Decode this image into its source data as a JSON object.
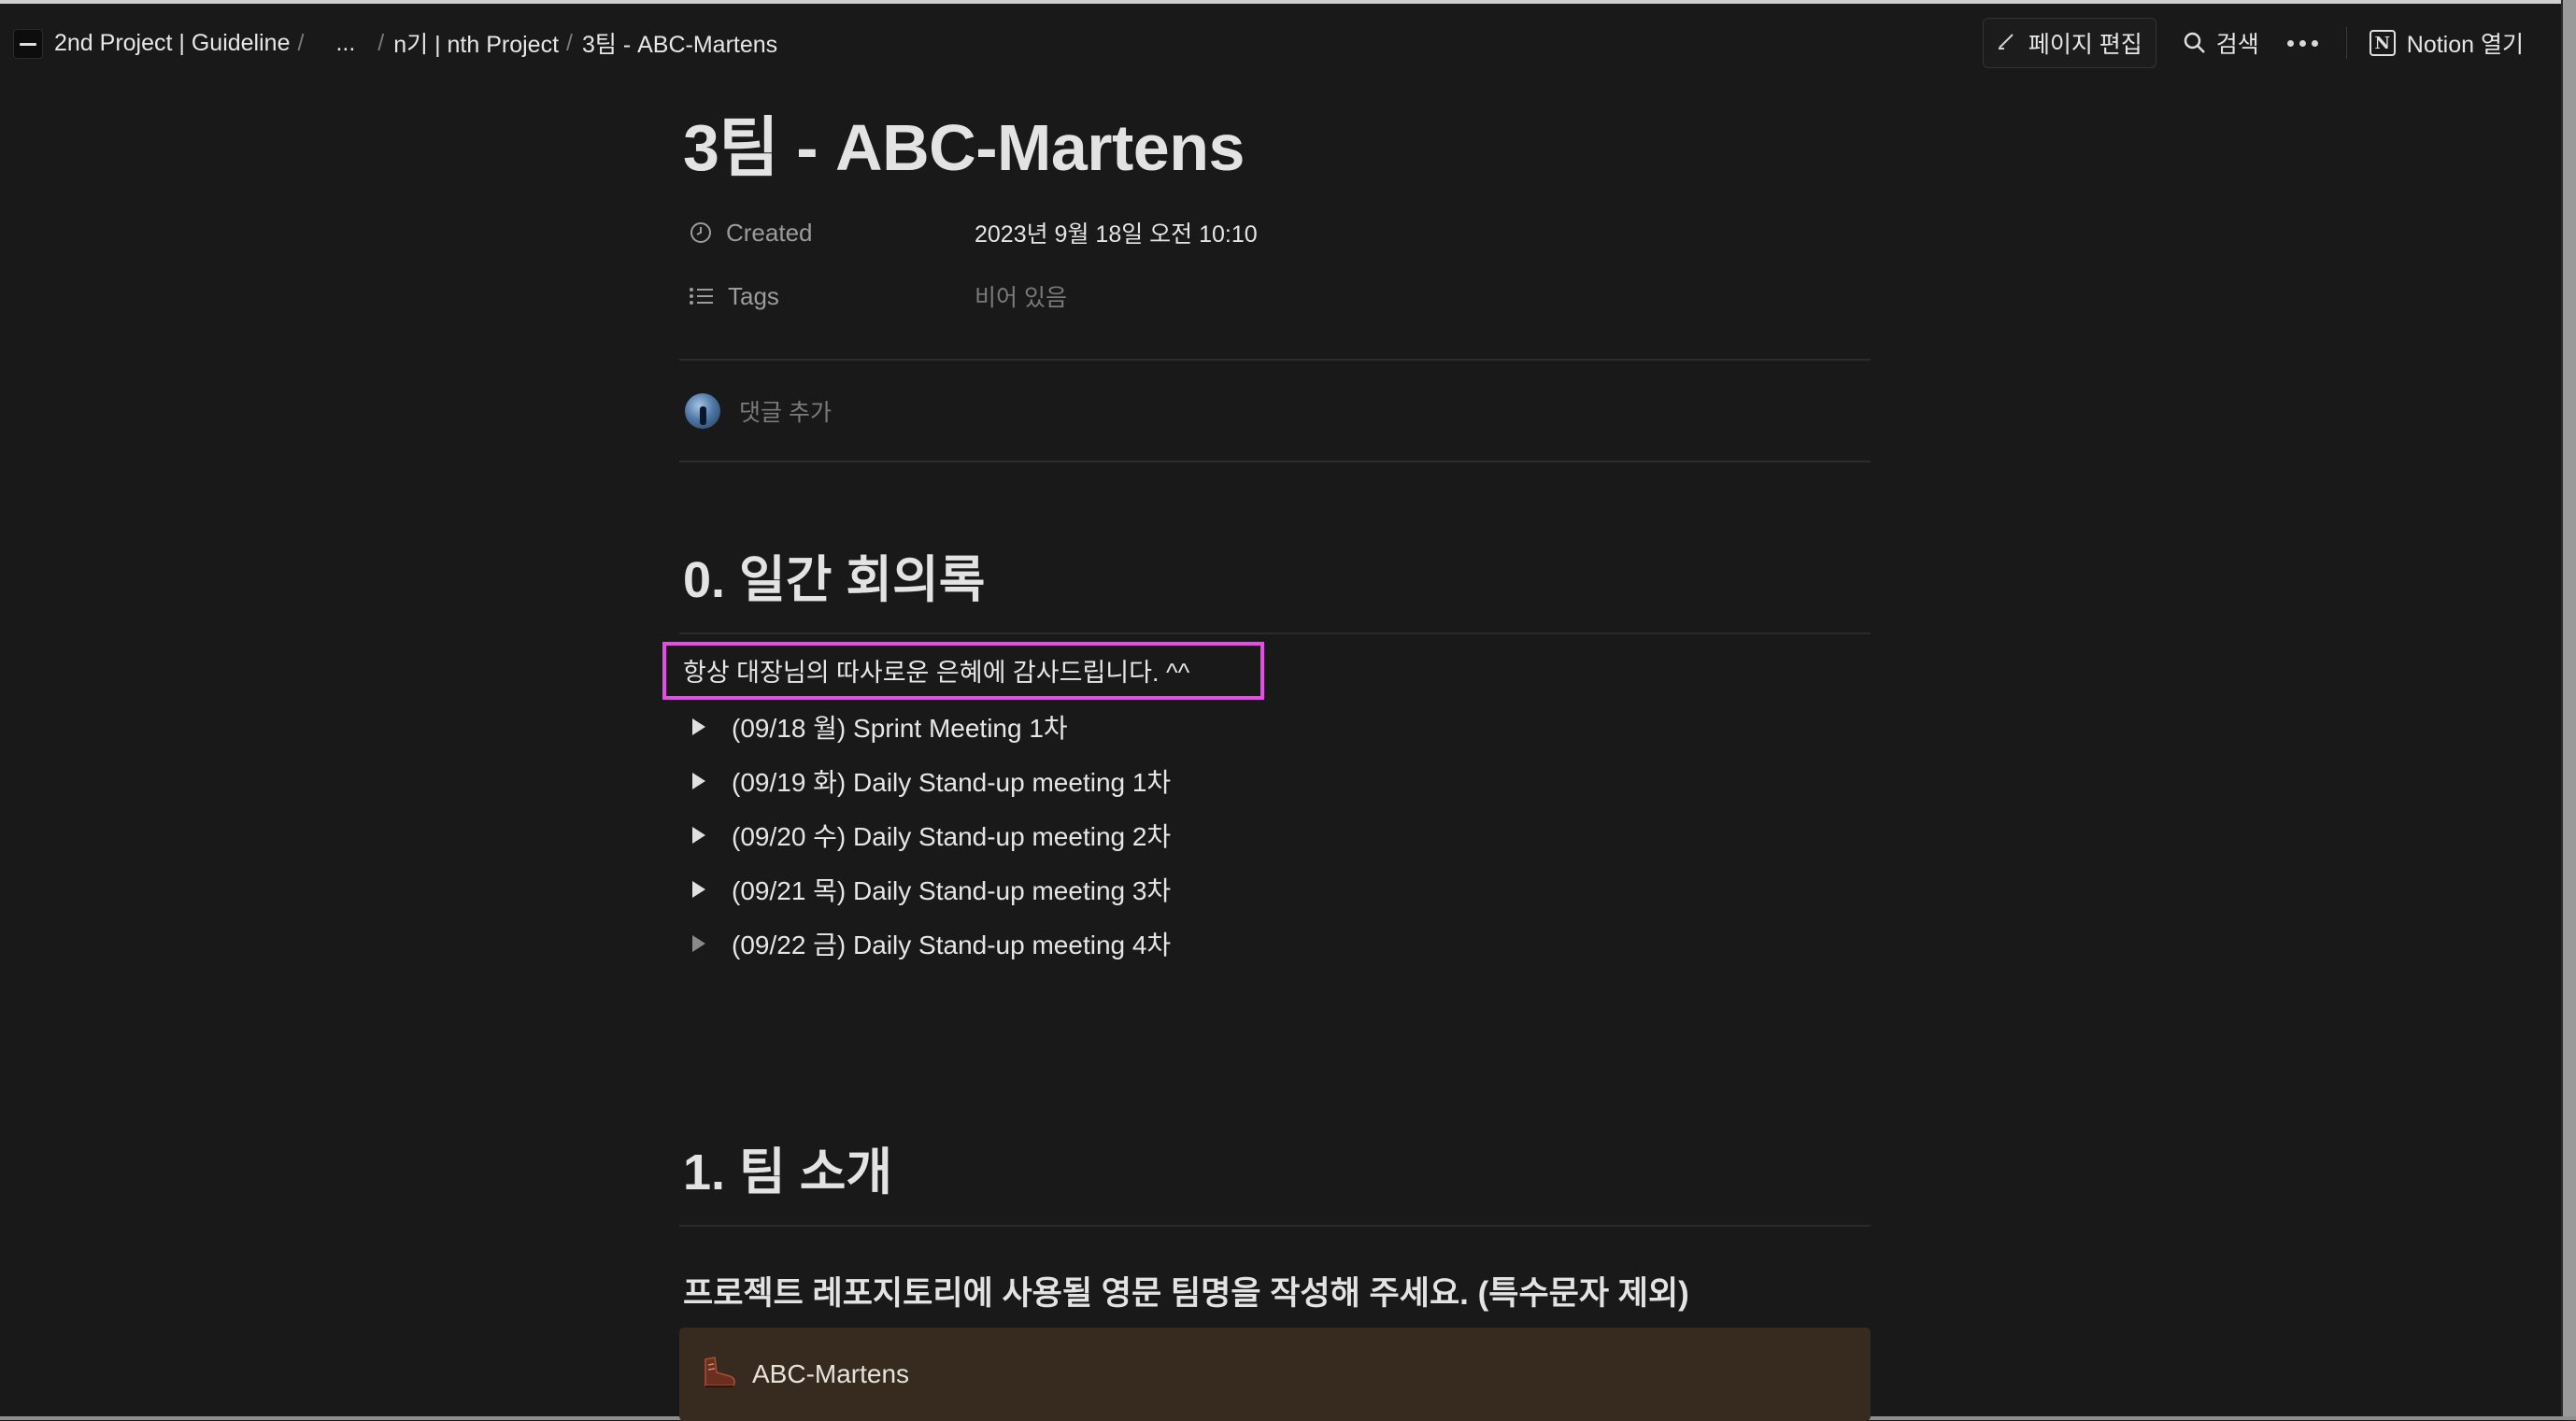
{
  "breadcrumb": {
    "items": [
      "2nd Project | Guideline",
      "...",
      "n기 | nth Project",
      "3팀 - ABC-Martens"
    ]
  },
  "top_actions": {
    "edit_label": "페이지 편집",
    "search_label": "검색",
    "notion_open_label": "Notion 열기",
    "notion_logo_letter": "N"
  },
  "page": {
    "title": "3팀 - ABC-Martens",
    "properties": {
      "created": {
        "name": "Created",
        "value": "2023년 9월 18일 오전 10:10"
      },
      "tags": {
        "name": "Tags",
        "value": "비어 있음"
      }
    },
    "comment_placeholder": "댓글 추가",
    "section0": {
      "heading": "0. 일간 회의록",
      "paragraph": "항상 대장님의 따사로운 은혜에 감사드립니다. ^^",
      "toggles": [
        "(09/18 월) Sprint Meeting 1차",
        "(09/19 화) Daily Stand-up meeting 1차",
        "(09/20 수) Daily Stand-up meeting 2차",
        "(09/21 목) Daily Stand-up meeting 3차",
        "(09/22 금) Daily Stand-up meeting 4차"
      ]
    },
    "section1": {
      "heading": "1. 팀 소개",
      "subheading": "프로젝트 레포지토리에 사용될 영문 팀명을 작성해 주세요. (특수문자 제외)",
      "callout": {
        "icon": "boot-icon",
        "text": "ABC-Martens"
      }
    }
  },
  "colors": {
    "background": "#191919",
    "callout_bg": "#372b1f",
    "highlight_border": "#e64ce6"
  }
}
